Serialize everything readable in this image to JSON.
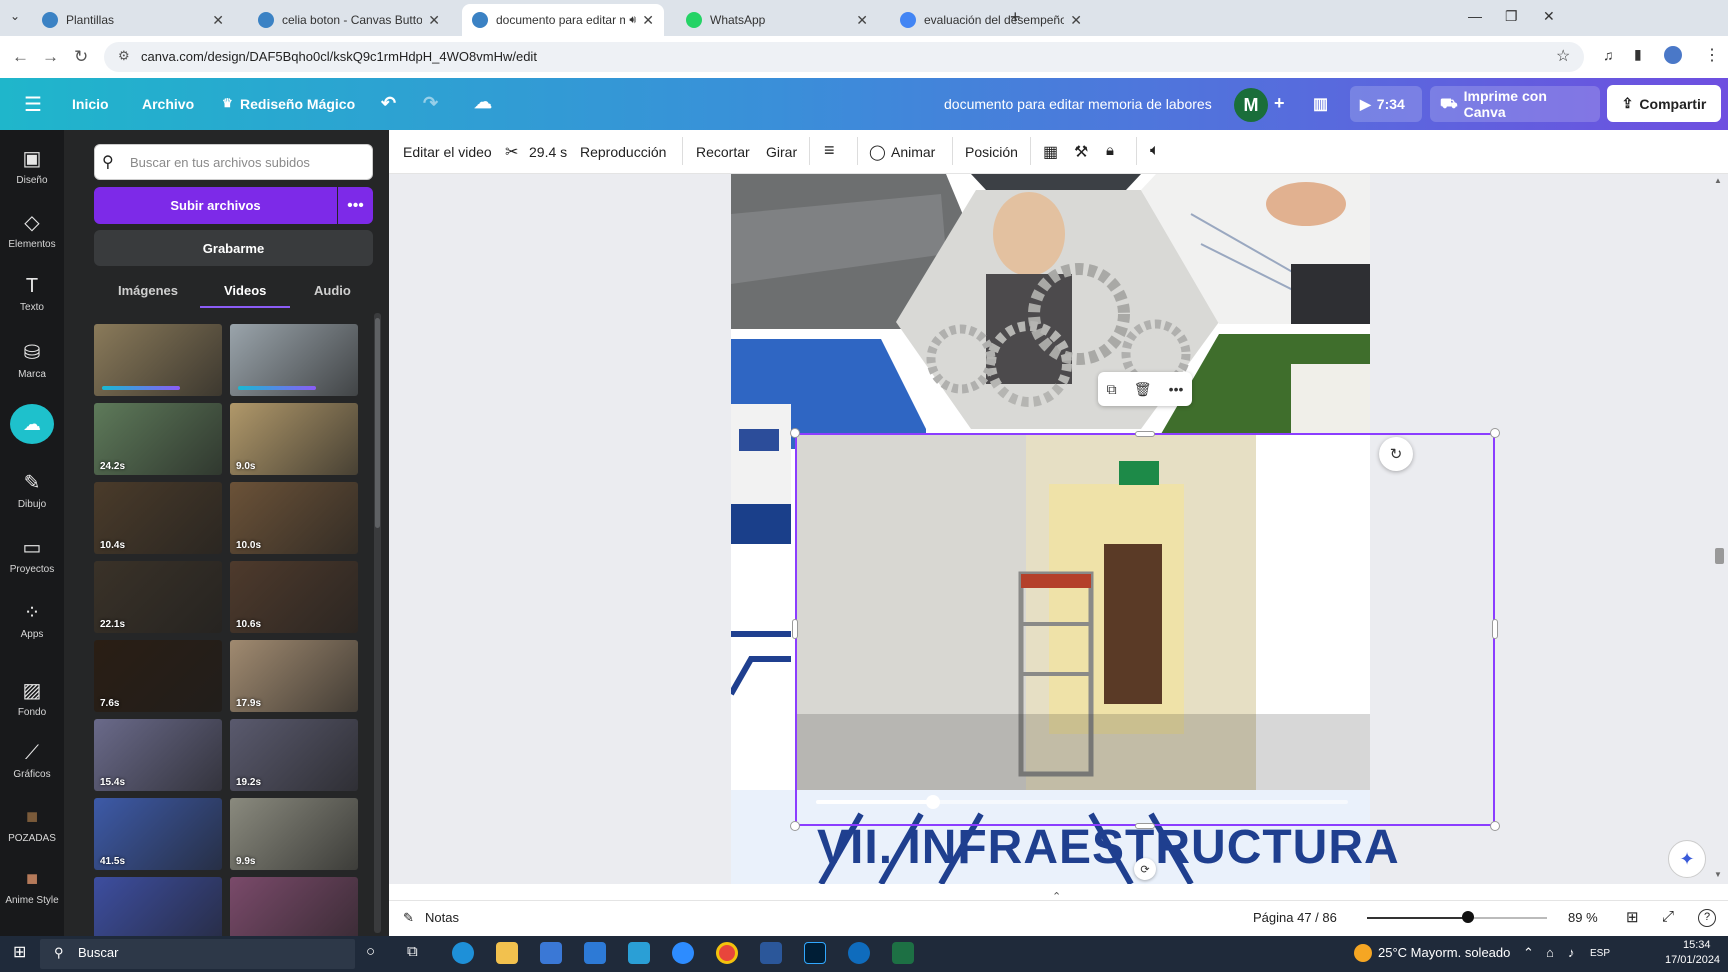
{
  "browser": {
    "tabs": [
      {
        "title": "Plantillas",
        "favicon_color": "#3b82c4"
      },
      {
        "title": "celia boton - Canvas Button",
        "favicon_color": "#3b82c4"
      },
      {
        "title": "documento para editar me",
        "favicon_color": "#3b82c4",
        "active": true
      },
      {
        "title": "WhatsApp",
        "favicon_color": "#25d366"
      },
      {
        "title": "evaluación del desempeño - Bú",
        "favicon_color": "#4285f4"
      }
    ],
    "url": "canva.com/design/DAF5Bqho0cl/kskQ9c1rmHdpH_4WO8vmHw/edit"
  },
  "header": {
    "menu": [
      "Inicio",
      "Archivo",
      "Rediseño Mágico"
    ],
    "doc_title": "documento para editar memoria de labores",
    "avatar_letter": "M",
    "timer": "7:34",
    "print_label": "Imprime con Canva",
    "share_label": "Compartir"
  },
  "rail": [
    {
      "label": "Diseño",
      "icon": "layout-icon"
    },
    {
      "label": "Elementos",
      "icon": "shapes-icon"
    },
    {
      "label": "Texto",
      "icon": "text-icon"
    },
    {
      "label": "Marca",
      "icon": "brand-icon"
    },
    {
      "label": "",
      "icon": "upload-icon"
    },
    {
      "label": "Dibujo",
      "icon": "draw-icon"
    },
    {
      "label": "Proyectos",
      "icon": "folder-icon"
    },
    {
      "label": "Apps",
      "icon": "apps-icon"
    },
    {
      "label": "Fondo",
      "icon": "background-icon"
    },
    {
      "label": "Gráficos",
      "icon": "charts-icon"
    },
    {
      "label": "POZADAS",
      "icon": "app-thumb-icon"
    },
    {
      "label": "Anime Style",
      "icon": "app-thumb-icon"
    }
  ],
  "panel": {
    "search_placeholder": "Buscar en tus archivos subidos",
    "upload_label": "Subir archivos",
    "record_label": "Grabarme",
    "tabs": [
      "Imágenes",
      "Videos",
      "Audio"
    ],
    "videos": [
      {
        "duration": "",
        "color": "#8a7a5a"
      },
      {
        "duration": "",
        "color": "#9aa4ab"
      },
      {
        "duration": "24.2s",
        "color": "#5e7a5a"
      },
      {
        "duration": "9.0s",
        "color": "#b0986a"
      },
      {
        "duration": "10.4s",
        "color": "#4a3b2a"
      },
      {
        "duration": "10.0s",
        "color": "#6b5238"
      },
      {
        "duration": "22.1s",
        "color": "#3a3228"
      },
      {
        "duration": "10.6s",
        "color": "#4e3a2c"
      },
      {
        "duration": "7.6s",
        "color": "#2a1e14"
      },
      {
        "duration": "17.9s",
        "color": "#a08a70"
      },
      {
        "duration": "15.4s",
        "color": "#6a6a8a"
      },
      {
        "duration": "19.2s",
        "color": "#5a5a6e"
      },
      {
        "duration": "41.5s",
        "color": "#3d5aa8"
      },
      {
        "duration": "9.9s",
        "color": "#8a8a7e"
      },
      {
        "duration": "",
        "color": "#3d4ea0"
      },
      {
        "duration": "",
        "color": "#7a4a6a"
      }
    ]
  },
  "toolbar": {
    "edit_video": "Editar el video",
    "duration": "29.4 s",
    "playback": "Reproducción",
    "crop": "Recortar",
    "flip": "Girar",
    "animate": "Animar",
    "position": "Posición"
  },
  "canvas": {
    "heading": "VII. INFRAESTRUCTURA",
    "video_progress": 0.22
  },
  "footer": {
    "notes": "Notas",
    "page_indicator": "Página 47 / 86",
    "zoom": "89 %"
  },
  "taskbar": {
    "search": "Buscar",
    "weather": "25°C  Mayorm. soleado",
    "lang": "ESP",
    "time": "15:34",
    "date": "17/01/2024"
  }
}
